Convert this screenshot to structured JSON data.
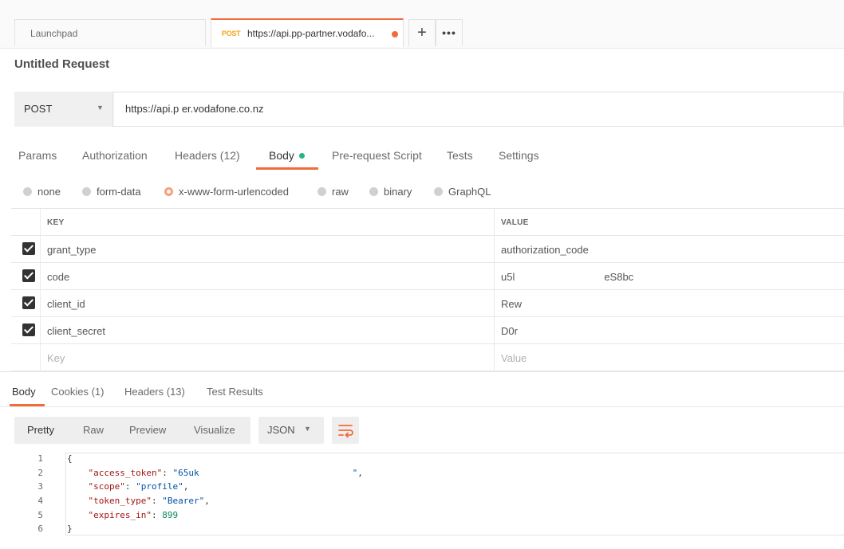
{
  "tabs": {
    "launchpad": "Launchpad",
    "active_method": "POST",
    "active_url": "https://api.pp-partner.vodafo...",
    "new_tab": "+",
    "more": "•••"
  },
  "request": {
    "title": "Untitled Request",
    "method": "POST",
    "url": "https://api.p          er.vodafone.co.nz"
  },
  "request_tabs": [
    {
      "label": "Params"
    },
    {
      "label": "Authorization"
    },
    {
      "label": "Headers (12)"
    },
    {
      "label": "Body"
    },
    {
      "label": "Pre-request Script"
    },
    {
      "label": "Tests"
    },
    {
      "label": "Settings"
    }
  ],
  "body_modes": [
    "none",
    "form-data",
    "x-www-form-urlencoded",
    "raw",
    "binary",
    "GraphQL"
  ],
  "body_mode_selected": "x-www-form-urlencoded",
  "table": {
    "headers": {
      "key": "KEY",
      "value": "VALUE"
    },
    "rows": [
      {
        "key": "grant_type",
        "value": "authorization_code",
        "checked": true
      },
      {
        "key": "code",
        "value": "u5l                               eS8bc",
        "checked": true
      },
      {
        "key": "client_id",
        "value": "Rew",
        "checked": true
      },
      {
        "key": "client_secret",
        "value": "D0r",
        "checked": true
      }
    ],
    "placeholder_key": "Key",
    "placeholder_value": "Value"
  },
  "response_tabs": [
    {
      "label": "Body"
    },
    {
      "label": "Cookies (1)"
    },
    {
      "label": "Headers (13)"
    },
    {
      "label": "Test Results"
    }
  ],
  "format_tabs": [
    "Pretty",
    "Raw",
    "Preview",
    "Visualize"
  ],
  "format_selected": "Pretty",
  "language": "JSON",
  "icons": {
    "wrap": "wrap-lines-icon",
    "caret": "chevron-down-icon"
  },
  "colors": {
    "accent": "#f26b3a",
    "post": "#f4a623",
    "green_dot": "#26b47f"
  },
  "code": {
    "line_numbers": [
      "1",
      "2",
      "3",
      "4",
      "5",
      "6"
    ],
    "lines": [
      {
        "k": "",
        "v": "{"
      },
      {
        "k": "\"access_token\"",
        "v": "\"65uk                             \""
      },
      {
        "k": "\"scope\"",
        "v": "\"profile\""
      },
      {
        "k": "\"token_type\"",
        "v": "\"Bearer\""
      },
      {
        "k": "\"expires_in\"",
        "v": "899"
      },
      {
        "k": "",
        "v": "}"
      }
    ]
  }
}
